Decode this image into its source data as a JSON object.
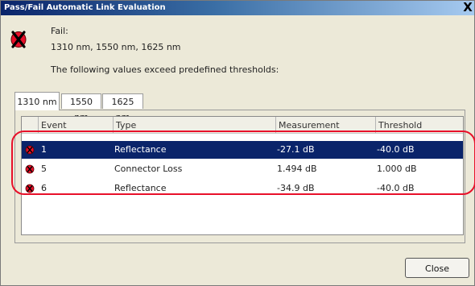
{
  "window": {
    "title": "Pass/Fail Automatic Link Evaluation",
    "close_glyph": "X"
  },
  "status": {
    "icon": "fail-x-icon",
    "label": "Fail:",
    "wavelengths": "1310 nm, 1550 nm, 1625 nm",
    "message": "The following values exceed predefined thresholds:"
  },
  "tabs": [
    {
      "label": "1310 nm",
      "active": true
    },
    {
      "label": "1550 nm",
      "active": false
    },
    {
      "label": "1625 nm",
      "active": false
    }
  ],
  "table": {
    "columns": [
      "Event",
      "Type",
      "Measurement",
      "Threshold"
    ],
    "rows": [
      {
        "event": "1",
        "type": "Reflectance",
        "measurement": "-27.1 dB",
        "threshold": "-40.0 dB",
        "selected": true,
        "icon": "fail-dot-icon"
      },
      {
        "event": "5",
        "type": "Connector Loss",
        "measurement": "1.494 dB",
        "threshold": "1.000 dB",
        "selected": false,
        "icon": "fail-dot-icon"
      },
      {
        "event": "6",
        "type": "Reflectance",
        "measurement": "-34.9 dB",
        "threshold": "-40.0 dB",
        "selected": false,
        "icon": "fail-dot-icon"
      }
    ]
  },
  "buttons": {
    "close_label": "Close"
  },
  "colors": {
    "selection": "#0a246a",
    "fail_red": "#e8102a",
    "dialog_bg": "#ece9d8"
  }
}
